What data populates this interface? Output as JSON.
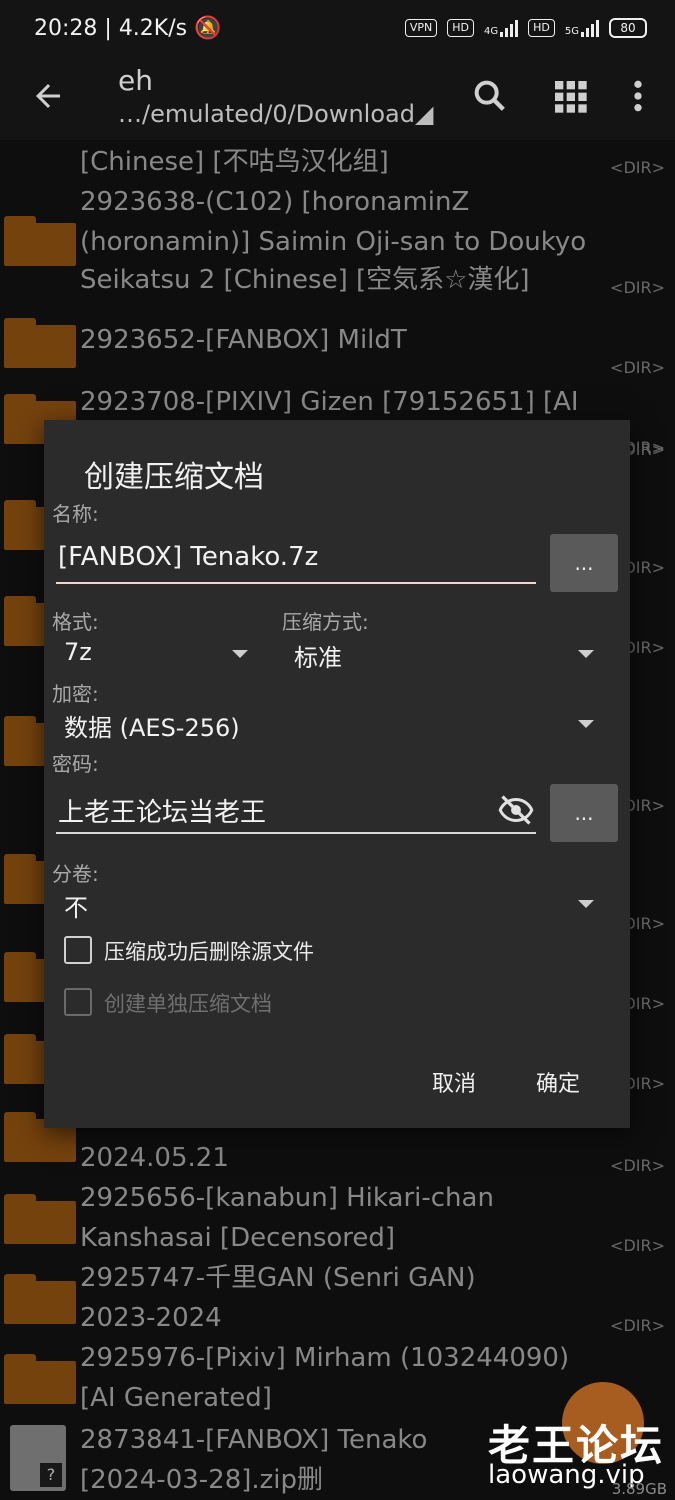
{
  "status_bar": {
    "time": "20:28",
    "speed": "4.2K/s",
    "vpn": "VPN",
    "hd": "HD",
    "net1": "4G",
    "net2": "5G",
    "battery": "80"
  },
  "toolbar": {
    "title": "eh",
    "path": "…/emulated/0/Download◢"
  },
  "files": [
    {
      "lines": [
        "[Chinese] [不咕鸟汉化组]"
      ],
      "dir": "<DIR>"
    },
    {
      "lines": [
        "2923638-(C102) [horonaminZ",
        "(horonamin)] Saimin Oji-san to Doukyo",
        "Seikatsu 2 [Chinese] [空気系☆漢化]"
      ],
      "dir": "<DIR>"
    },
    {
      "lines": [
        "2923652-[FANBOX] MildT"
      ],
      "dir": "<DIR>"
    },
    {
      "lines": [
        "2923708-[PIXIV] Gizen [79152651] [AI"
      ],
      "dir": "<DIR>"
    },
    {
      "lines": [
        "2024.05.21"
      ],
      "dir": "<DIR>"
    },
    {
      "lines": [
        "2925656-[kanabun] Hikari-chan",
        "Kanshasai [Decensored]"
      ],
      "dir": "<DIR>"
    },
    {
      "lines": [
        "2925747-千里GAN (Senri GAN)",
        "2023-2024"
      ],
      "dir": "<DIR>"
    },
    {
      "lines": [
        "2925976-[Pixiv] Mirham (103244090)",
        "[AI Generated]"
      ],
      "dir": "<DIR>"
    },
    {
      "lines": [
        "2873841-[FANBOX] Tenako",
        "[2024-03-28].zip删"
      ],
      "dir": ""
    }
  ],
  "hidden_dir_tags": [
    "DIR>",
    "DIR>",
    "DIR>",
    "DIR>",
    "DIR>",
    "DIR>",
    "DIR>"
  ],
  "dialog": {
    "title": "创建压缩文档",
    "name_label": "名称:",
    "name_value": "[FANBOX] Tenako.7z",
    "dots": "...",
    "format_label": "格式:",
    "format_value": "7z",
    "method_label": "压缩方式:",
    "method_value": "标准",
    "encryption_label": "加密:",
    "encryption_value": "数据 (AES-256)",
    "password_label": "密码:",
    "password_value": "上老王论坛当老王",
    "split_label": "分卷:",
    "split_value": "不",
    "delete_source_label": "压缩成功后删除源文件",
    "separate_archives_label": "创建单独压缩文档",
    "cancel": "取消",
    "ok": "确定"
  },
  "watermark": {
    "main": "老王论坛",
    "sub": "laowang.vip"
  },
  "storage_size": "3.89GB"
}
